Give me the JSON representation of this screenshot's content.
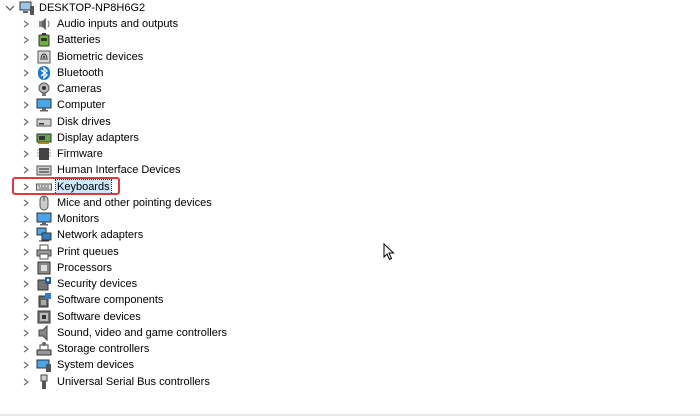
{
  "root": {
    "label": "DESKTOP-NP8H6G2",
    "expanded": true,
    "icon": "computer-icon"
  },
  "devices": [
    {
      "label": "Audio inputs and outputs",
      "icon": "speaker-icon"
    },
    {
      "label": "Batteries",
      "icon": "battery-icon"
    },
    {
      "label": "Biometric devices",
      "icon": "biometric-icon"
    },
    {
      "label": "Bluetooth",
      "icon": "bluetooth-icon"
    },
    {
      "label": "Cameras",
      "icon": "camera-icon"
    },
    {
      "label": "Computer",
      "icon": "monitor-icon"
    },
    {
      "label": "Disk drives",
      "icon": "disk-drive-icon"
    },
    {
      "label": "Display adapters",
      "icon": "display-adapter-icon"
    },
    {
      "label": "Firmware",
      "icon": "firmware-icon"
    },
    {
      "label": "Human Interface Devices",
      "icon": "hid-icon"
    },
    {
      "label": "Keyboards",
      "icon": "keyboard-icon",
      "selected": true
    },
    {
      "label": "Mice and other pointing devices",
      "icon": "mouse-icon"
    },
    {
      "label": "Monitors",
      "icon": "monitor-icon"
    },
    {
      "label": "Network adapters",
      "icon": "network-icon"
    },
    {
      "label": "Print queues",
      "icon": "printer-icon"
    },
    {
      "label": "Processors",
      "icon": "processor-icon"
    },
    {
      "label": "Security devices",
      "icon": "security-icon"
    },
    {
      "label": "Software components",
      "icon": "software-component-icon"
    },
    {
      "label": "Software devices",
      "icon": "software-device-icon"
    },
    {
      "label": "Sound, video and game controllers",
      "icon": "sound-icon"
    },
    {
      "label": "Storage controllers",
      "icon": "storage-icon"
    },
    {
      "label": "System devices",
      "icon": "system-icon"
    },
    {
      "label": "Universal Serial Bus controllers",
      "icon": "usb-icon"
    }
  ],
  "colors": {
    "highlight_border": "#e0383c",
    "selection_bg": "#cce8ff"
  }
}
